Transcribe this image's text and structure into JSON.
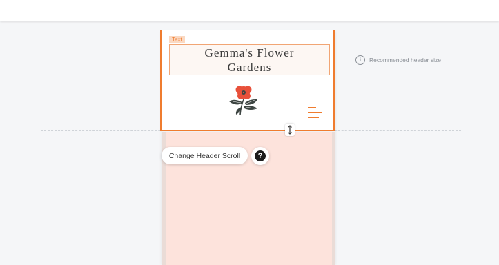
{
  "editor": {
    "recommended_note": "Recommended header size",
    "info_icon_glyph": "i"
  },
  "header": {
    "element_tag": "Text",
    "site_title": "Gemma's Flower Gardens",
    "logo_icon": "flower-icon",
    "menu_icon": "hamburger-menu-icon"
  },
  "controls": {
    "change_scroll_label": "Change Header Scroll",
    "help_glyph": "?"
  },
  "colors": {
    "selection_accent": "#ef7c2f",
    "page_body": "#fde3dc",
    "flower_red": "#e8503a",
    "leaf_dark": "#3d4542"
  }
}
